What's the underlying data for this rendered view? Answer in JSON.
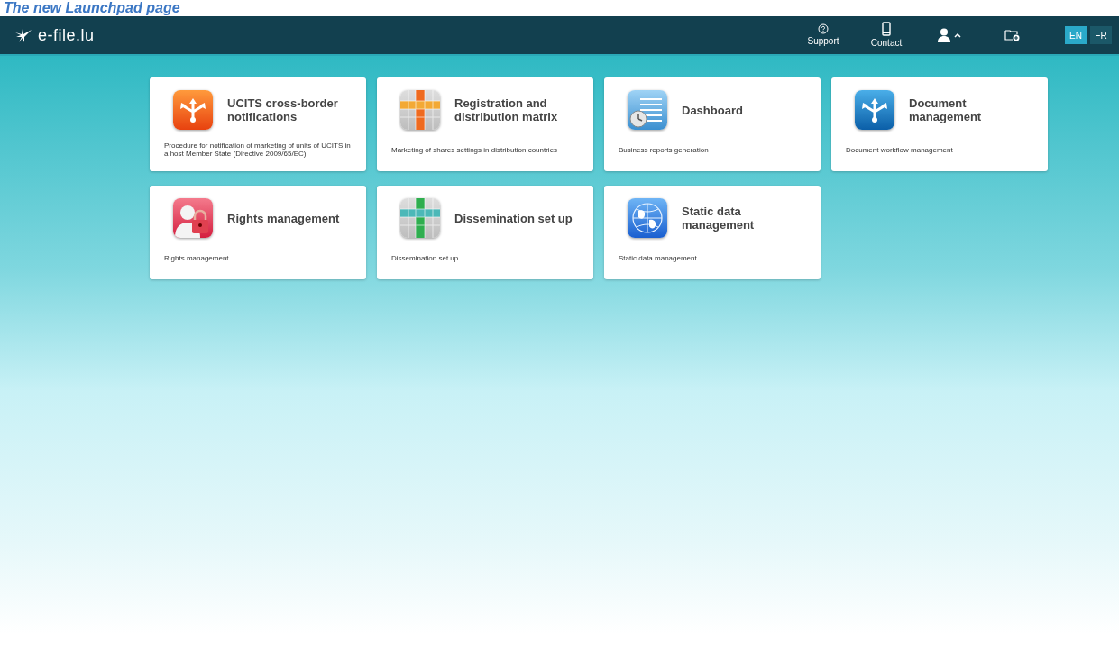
{
  "caption": "The new Launchpad page",
  "header": {
    "logo_text": "e-file.lu",
    "nav": [
      {
        "kind": "support",
        "label": "Support"
      },
      {
        "kind": "contact",
        "label": "Contact"
      },
      {
        "kind": "user"
      },
      {
        "kind": "folder"
      }
    ],
    "languages": [
      {
        "label": "EN",
        "selected": true
      },
      {
        "label": "FR",
        "selected": false
      }
    ]
  },
  "tiles": [
    {
      "kind": "arrows-orange",
      "title": "UCITS cross-border notifications",
      "description": "Procedure for notification of marketing of units of UCITS in a host Member State (Directive 2009/65/EC)"
    },
    {
      "kind": "grid-orange",
      "title": "Registration and distribution matrix",
      "description": "Marketing of shares settings in distribution countries"
    },
    {
      "kind": "dashboard",
      "title": "Dashboard",
      "description": "Business reports generation"
    },
    {
      "kind": "arrows-blue",
      "title": "Document management",
      "description": "Document workflow management"
    },
    {
      "kind": "lock",
      "title": "Rights management",
      "description": "Rights management"
    },
    {
      "kind": "grid-green",
      "title": "Dissemination set up",
      "description": "Dissemination set up"
    },
    {
      "kind": "globe",
      "title": "Static data management",
      "description": "Static data management"
    }
  ]
}
